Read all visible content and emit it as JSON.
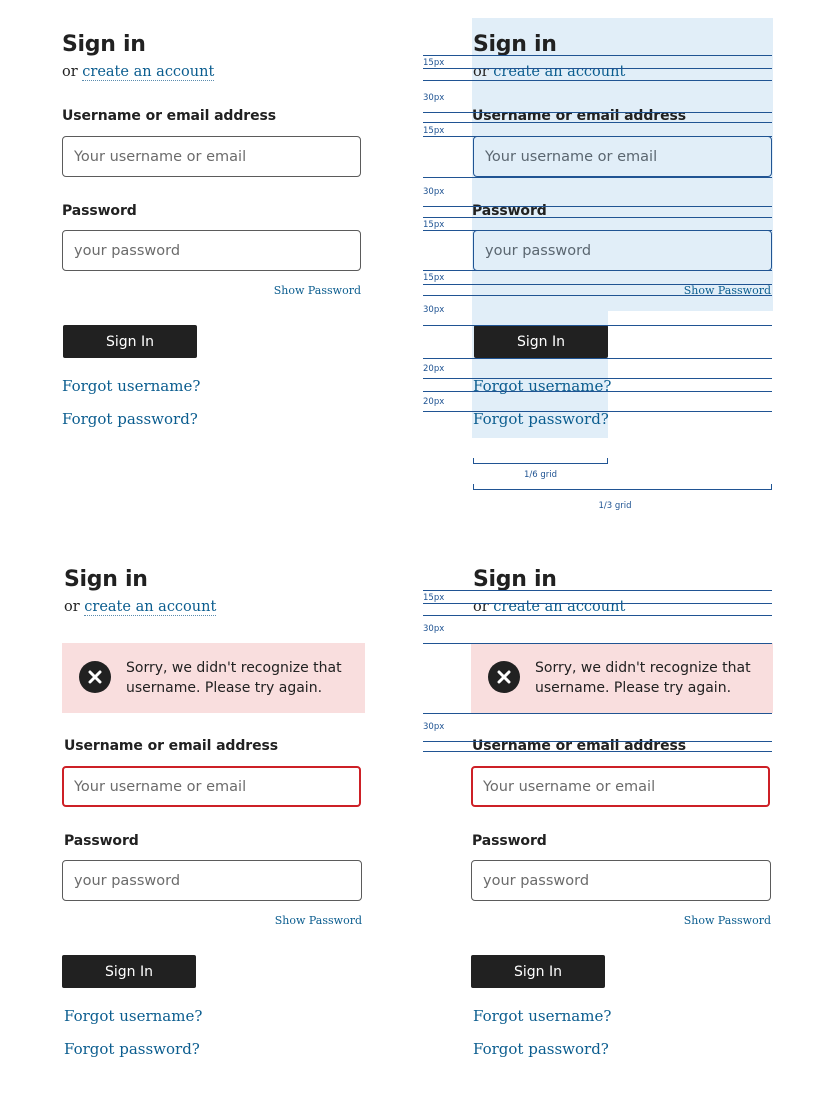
{
  "signin": {
    "title": "Sign in",
    "or_text": "or",
    "create_account": "create an account",
    "username_label": "Username or email address",
    "username_placeholder": "Your username or email",
    "password_label": "Password",
    "password_placeholder": "your password",
    "show_password": "Show Password",
    "submit_label": "Sign In",
    "forgot_username": "Forgot username?",
    "forgot_password": "Forgot password?"
  },
  "error": {
    "message": "Sorry, we didn't recognize that username. Please try again.",
    "icon": "error-x-icon"
  },
  "spacing": {
    "s15": "15px",
    "s20": "20px",
    "s30": "30px",
    "grid_sixth": "1/6 grid",
    "grid_third": "1/3 grid"
  },
  "colors": {
    "link": "#0b5d8f",
    "button_bg": "#212121",
    "error_border": "#cd2026",
    "error_bg": "#f9dede",
    "guide": "#205493",
    "guide_shade": "#e1eef8"
  }
}
